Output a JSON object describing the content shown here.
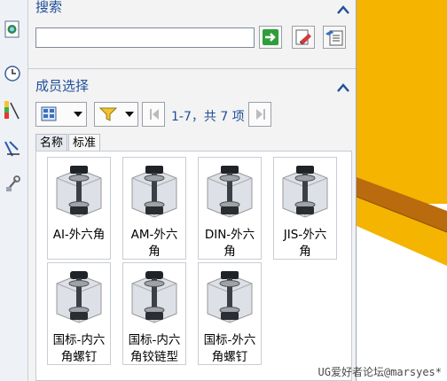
{
  "search": {
    "title": "搜索"
  },
  "members": {
    "title": "成员选择",
    "page_label": "1-7，共 7 项",
    "tabs": [
      "名称",
      "标准"
    ],
    "items": [
      {
        "line1": "AI-外六角",
        "line2": ""
      },
      {
        "line1": "AM-外六",
        "line2": "角"
      },
      {
        "line1": "DIN-外六",
        "line2": "角"
      },
      {
        "line1": "JIS-外六",
        "line2": "角"
      },
      {
        "line1": "国标-内六",
        "line2": "角螺钉"
      },
      {
        "line1": "国标-内六",
        "line2": "角铰链型"
      },
      {
        "line1": "国标-外六",
        "line2": "角螺钉"
      }
    ]
  },
  "watermark": "UG爱好者论坛@marsyes*",
  "colors": {
    "accent": "#1f4f9a",
    "viewport_yellow": "#f5b400",
    "viewport_orange": "#b96b0e"
  }
}
